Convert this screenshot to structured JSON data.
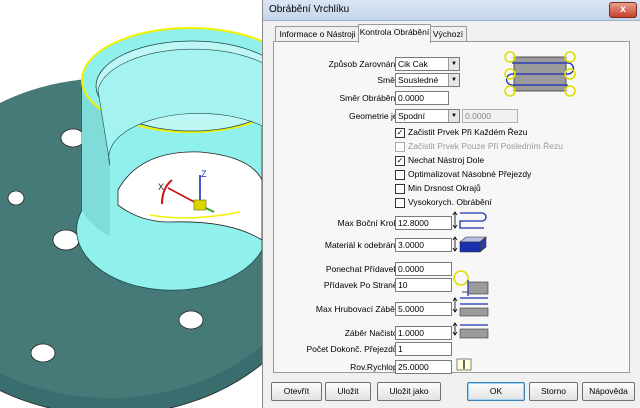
{
  "window": {
    "title": "Obrábění Vrchlíku",
    "close_glyph": "x"
  },
  "tabs": [
    {
      "label": "Informace o Nástroji",
      "active": false
    },
    {
      "label": "Kontrola Obrábění",
      "active": true
    },
    {
      "label": "Výchozí",
      "active": false
    }
  ],
  "form": {
    "zpusob_zarovnani": {
      "label": "Způsob Zarovnání:",
      "value": "Cik Cak"
    },
    "smer": {
      "label": "Směr:",
      "value": "Sousledné"
    },
    "smer_obrabeni": {
      "label": "Směr Obrábění:",
      "value": "0.0000"
    },
    "geometrie": {
      "label": "Geometrie je:",
      "value": "Spodní",
      "extra_value": "0.0000"
    },
    "checkboxes": [
      {
        "label": "Začistit Prvek Při Každém Řezu",
        "checked": true,
        "enabled": true
      },
      {
        "label": "Začistit Prvek Pouze Při Posledním Řezu",
        "checked": false,
        "enabled": false
      },
      {
        "label": "Nechat Nástroj Dole",
        "checked": true,
        "enabled": true
      },
      {
        "label": "Optimalizovat Násobné Přejezdy",
        "checked": false,
        "enabled": true
      },
      {
        "label": "Min Drsnost Okrajů",
        "checked": false,
        "enabled": true
      },
      {
        "label": "Vysokorych. Obrábění",
        "checked": false,
        "enabled": true
      }
    ],
    "check_mark": "✓",
    "max_bocni_krok": {
      "label": "Max Boční Krok:",
      "value": "12.8000"
    },
    "material_k_odebrani": {
      "label": "Materiál k odebrání:",
      "value": "3.0000"
    },
    "ponechat_pridavek": {
      "label": "Ponechat Přídavek:",
      "value": "0.0000"
    },
    "pridavek_po_strane": {
      "label": "Přídavek Po Straně:",
      "value": "10"
    },
    "max_hrubovaci_zaber": {
      "label": "Max Hrubovací Záběr:",
      "value": "5.0000"
    },
    "zaber_nacisto": {
      "label": "Záběr Načisto:",
      "value": "1.0000"
    },
    "pocet_dokonc_prejezdu": {
      "label": "Počet Dokonč. Přejezdů:",
      "value": "1"
    },
    "rov_rychlop": {
      "label": "Rov.Rychlop:",
      "value": "25.0000"
    }
  },
  "buttons": {
    "otevrit": "Otevřít",
    "ulozit": "Uložit",
    "ulozit_jako": "Uložit jako",
    "ok": "OK",
    "storno": "Storno",
    "napoveda": "Nápověda"
  },
  "viewport": {
    "axis_label_z": "Z",
    "axis_label_x": "X",
    "part_color": "#8ff0ec",
    "part_dark": "#3a6e6e",
    "edge_highlight": "#f2f200"
  }
}
